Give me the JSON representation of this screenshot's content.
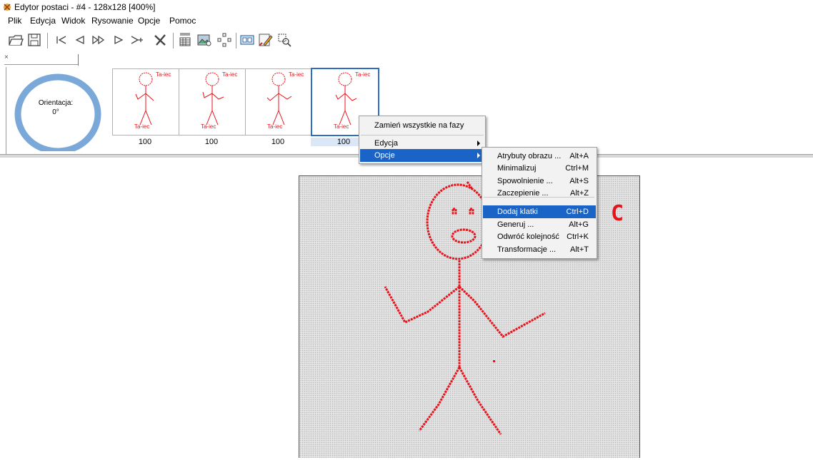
{
  "window": {
    "title": "Edytor postaci - #4 - 128x128 [400%]"
  },
  "menu": [
    "Plik",
    "Edycja",
    "Widok",
    "Rysowanie",
    "Opcje",
    "Pomoc"
  ],
  "toolbar": {
    "icons": [
      "open-folder-icon",
      "save-disk-icon",
      "first-frame-icon",
      "prev-frame-icon",
      "fast-forward-icon",
      "play-icon",
      "last-frame-icon",
      "delete-x-icon",
      "frames-grid-icon",
      "image-preview-icon",
      "anchor-points-icon",
      "frame-view-icon",
      "edit-pencil-icon",
      "zoom-select-icon"
    ]
  },
  "tab": {
    "close_glyph": "×"
  },
  "orientation": {
    "label": "Orientacja:",
    "value": "0°"
  },
  "frames": [
    {
      "label": "Ta-iec",
      "value": "100"
    },
    {
      "label": "Ta-iec",
      "value": "100"
    },
    {
      "label": "Ta-iec",
      "value": "100"
    },
    {
      "label": "Ta-iec",
      "value": "100"
    }
  ],
  "canvas": {
    "overflow_text": "C",
    "stroke_color": "#e8121b"
  },
  "context_menu": {
    "items": [
      "Zamień wszystkie na fazy",
      "Edycja",
      "Opcje"
    ]
  },
  "submenu": {
    "items": [
      {
        "label": "Atrybuty obrazu ...",
        "shortcut": "Alt+A"
      },
      {
        "label": "Minimalizuj",
        "shortcut": "Ctrl+M"
      },
      {
        "label": "Spowolnienie ...",
        "shortcut": "Alt+S"
      },
      {
        "label": "Zaczepienie ...",
        "shortcut": "Alt+Z"
      },
      {
        "label": "Dodaj klatki",
        "shortcut": "Ctrl+D"
      },
      {
        "label": "Generuj ...",
        "shortcut": "Alt+G"
      },
      {
        "label": "Odwróć kolejność",
        "shortcut": "Ctrl+K"
      },
      {
        "label": "Transformacje ...",
        "shortcut": "Alt+T"
      }
    ]
  },
  "colors": {
    "accent": "#1a63c7",
    "selection_border": "#2d6cc0",
    "orientation_ring": "#7aa8d8"
  }
}
